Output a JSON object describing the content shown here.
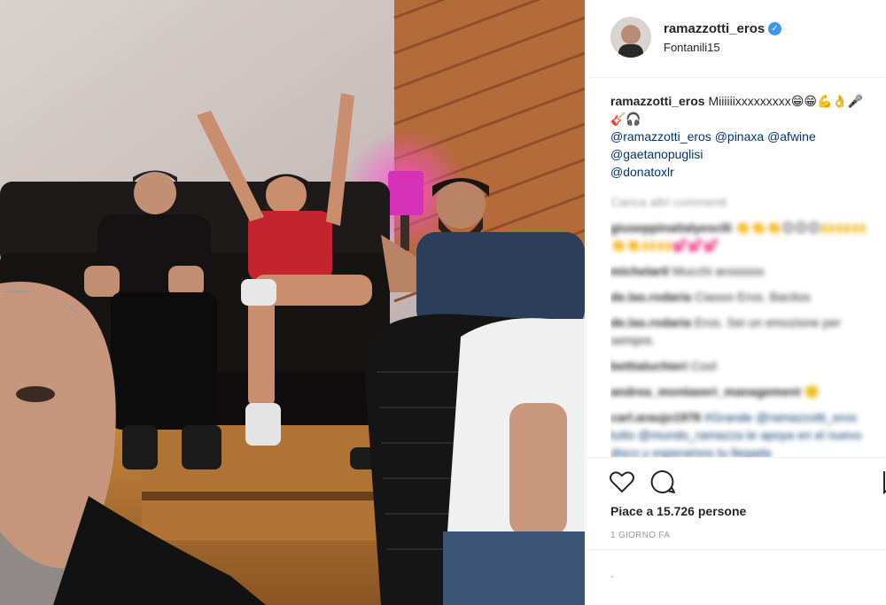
{
  "post": {
    "username": "ramazzotti_eros",
    "verified": true,
    "location": "Fontanili15",
    "caption_user": "ramazzotti_eros",
    "caption_text": "Miiiiiixxxxxxxxx😁😁💪👌🎤🎸🎧",
    "caption_tags": [
      "@ramazzotti_eros",
      "@pinaxa",
      "@afwine",
      "@gaetanopuglisi",
      "@donatoxlr"
    ],
    "load_more": "Carica altri commenti",
    "likes": "Piace a 15.726 persone",
    "time": "1 GIORNO FA",
    "add_comment_placeholder": "."
  },
  "comments": [
    {
      "user": "giuseppinaitalyesclli",
      "text": "👏👏👏😊😊😊🙌🙌🙌 👏👏🙌🙌💕💕💕"
    },
    {
      "user": "michelartl",
      "text": "Mucchi arosssss"
    },
    {
      "user": "de.las.rodaria",
      "text": "Ciaooo Eros. Bacitos"
    },
    {
      "user": "de.las.rodaria",
      "text": "Eros. Sei un emozione per sempre."
    },
    {
      "user": "bettialuchieri",
      "text": "Cool"
    },
    {
      "user": "andrea_montaeeri_management",
      "text": "🙂"
    },
    {
      "user": "carl.araujo1978",
      "text": "#Grande @ramazzotti_eros tutto @mundo_ramazza te apoya en el nuevo disco y esperamos tu llegada"
    }
  ],
  "icons": {
    "like": "heart-icon",
    "comment": "comment-bubble-icon",
    "save": "bookmark-icon",
    "verified": "verified-badge-icon"
  },
  "colors": {
    "link": "#003569",
    "verified": "#3897f0",
    "muted": "#999999",
    "border": "#efefef"
  }
}
